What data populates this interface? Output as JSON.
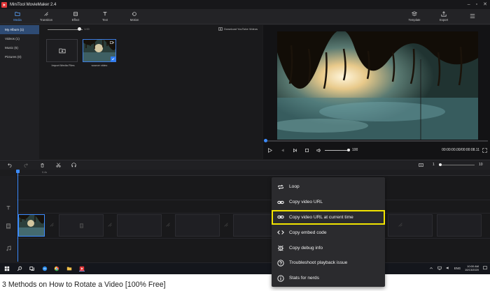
{
  "app": {
    "title": "MiniTool MovieMaker 2.4",
    "accent": "#3d8cff",
    "brand": "#e2383a"
  },
  "toolbar": {
    "tools": [
      {
        "label": "Media",
        "icon": "folder-icon",
        "active": true
      },
      {
        "label": "Transition",
        "icon": "transition-icon",
        "active": false
      },
      {
        "label": "Effect",
        "icon": "effect-icon",
        "active": false
      },
      {
        "label": "Text",
        "icon": "text-icon",
        "active": false
      },
      {
        "label": "Motion",
        "icon": "motion-icon",
        "active": false
      }
    ],
    "template_label": "Template",
    "export_label": "Export"
  },
  "sidebar": {
    "items": [
      {
        "label": "My Album  (1)",
        "active": true
      },
      {
        "label": "Videos  (1)",
        "active": false
      },
      {
        "label": "Music  (6)",
        "active": false
      },
      {
        "label": "Pictures  (0)",
        "active": false
      }
    ]
  },
  "media": {
    "zoom_value": "1:00",
    "download_label": "Download YouTube Videos",
    "import_label": "Import Media Files",
    "clip_label": "source video"
  },
  "player": {
    "volume": "100",
    "timecode": "00:00:00.00/00:00:08.11"
  },
  "timeline": {
    "zoom_min": "1",
    "zoom_max": "10",
    "ruler": [
      "0s",
      "0.4s"
    ]
  },
  "context_menu": {
    "items": [
      {
        "label": "Loop",
        "icon": "loop-icon"
      },
      {
        "label": "Copy video URL",
        "icon": "link-icon"
      },
      {
        "label": "Copy video URL at current time",
        "icon": "link-icon",
        "highlighted": true
      },
      {
        "label": "Copy embed code",
        "icon": "code-icon"
      },
      {
        "label": "Copy debug info",
        "icon": "bug-icon"
      },
      {
        "label": "Troubleshoot playback issue",
        "icon": "help-icon"
      },
      {
        "label": "Stats for nerds",
        "icon": "info-icon"
      }
    ],
    "highlight_color": "#f2e400"
  },
  "taskbar": {
    "lang": "ENG",
    "time": "10:00 AM",
    "date": "10/13/2020"
  },
  "caption": "3 Methods on How to Rotate a Video [100% Free]"
}
